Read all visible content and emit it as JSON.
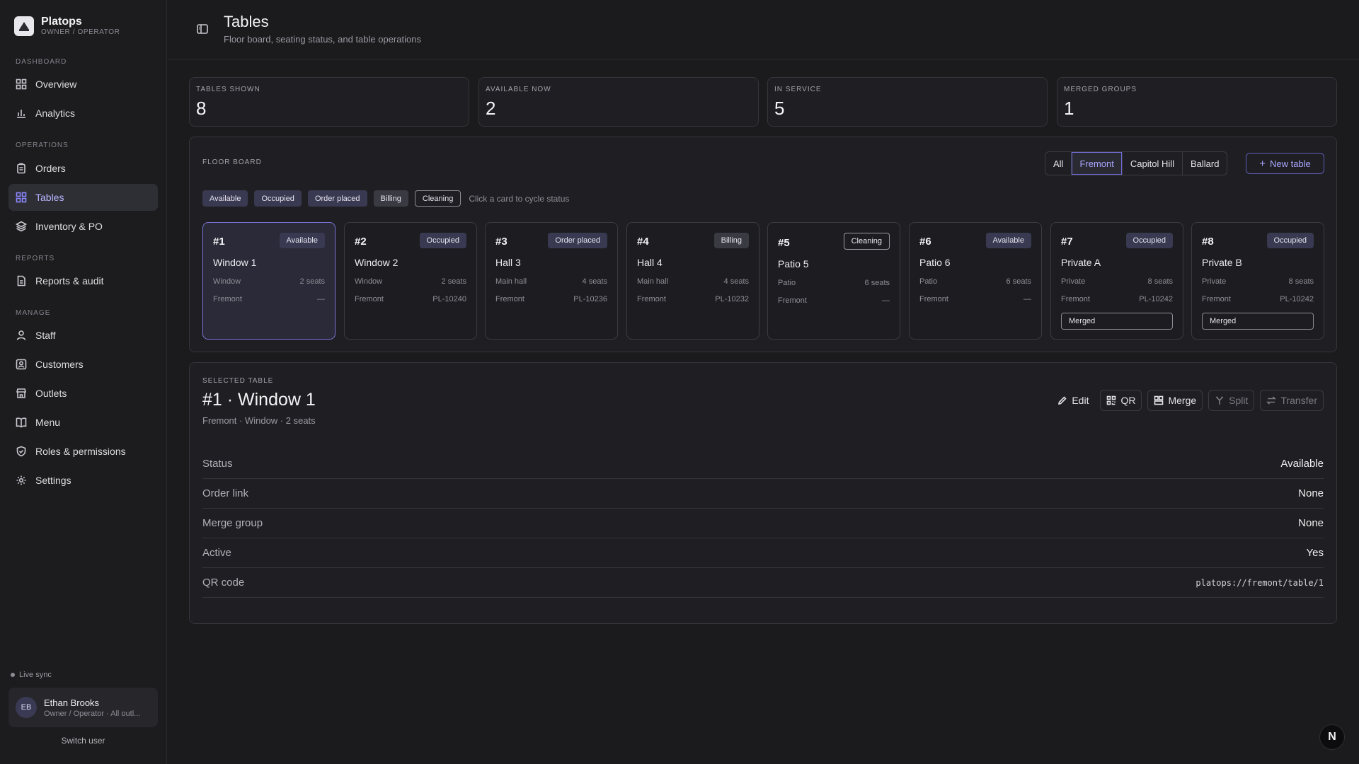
{
  "app": {
    "name": "Platops",
    "role": "OWNER / OPERATOR"
  },
  "sidebar": {
    "sections": [
      {
        "label": "DASHBOARD"
      },
      {
        "label": "OPERATIONS"
      },
      {
        "label": "REPORTS"
      },
      {
        "label": "MANAGE"
      }
    ],
    "items": [
      {
        "label": "Overview",
        "icon": "grid-icon"
      },
      {
        "label": "Analytics",
        "icon": "bar-chart-icon"
      },
      {
        "label": "Orders",
        "icon": "clipboard-icon"
      },
      {
        "label": "Tables",
        "icon": "grid-icon",
        "active": true
      },
      {
        "label": "Inventory & PO",
        "icon": "layers-icon"
      },
      {
        "label": "Reports & audit",
        "icon": "file-icon"
      },
      {
        "label": "Staff",
        "icon": "user-icon"
      },
      {
        "label": "Customers",
        "icon": "contact-icon"
      },
      {
        "label": "Outlets",
        "icon": "store-icon"
      },
      {
        "label": "Menu",
        "icon": "book-icon"
      },
      {
        "label": "Roles & permissions",
        "icon": "shield-icon"
      },
      {
        "label": "Settings",
        "icon": "gear-icon"
      }
    ],
    "live_sync": "Live sync",
    "user": {
      "initials": "EB",
      "name": "Ethan Brooks",
      "role": "Owner / Operator · All outl..."
    },
    "switch_user": "Switch user"
  },
  "header": {
    "title": "Tables",
    "subtitle": "Floor board, seating status, and table operations"
  },
  "stats": [
    {
      "label": "TABLES SHOWN",
      "value": "8"
    },
    {
      "label": "AVAILABLE NOW",
      "value": "2"
    },
    {
      "label": "IN SERVICE",
      "value": "5"
    },
    {
      "label": "MERGED GROUPS",
      "value": "1"
    }
  ],
  "floor_board": {
    "label": "FLOOR BOARD",
    "filters": [
      "All",
      "Fremont",
      "Capitol Hill",
      "Ballard"
    ],
    "active_filter": "Fremont",
    "new_table": "New table",
    "legend": [
      "Available",
      "Occupied",
      "Order placed",
      "Billing",
      "Cleaning"
    ],
    "hint": "Click a card to cycle status",
    "tables": [
      {
        "num": "#1",
        "status": "Available",
        "name": "Window 1",
        "area": "Window",
        "seats": "2 seats",
        "outlet": "Fremont",
        "order": "—",
        "merged": ""
      },
      {
        "num": "#2",
        "status": "Occupied",
        "name": "Window 2",
        "area": "Window",
        "seats": "2 seats",
        "outlet": "Fremont",
        "order": "PL-10240",
        "merged": ""
      },
      {
        "num": "#3",
        "status": "Order placed",
        "name": "Hall 3",
        "area": "Main hall",
        "seats": "4 seats",
        "outlet": "Fremont",
        "order": "PL-10236",
        "merged": ""
      },
      {
        "num": "#4",
        "status": "Billing",
        "name": "Hall 4",
        "area": "Main hall",
        "seats": "4 seats",
        "outlet": "Fremont",
        "order": "PL-10232",
        "merged": ""
      },
      {
        "num": "#5",
        "status": "Cleaning",
        "name": "Patio 5",
        "area": "Patio",
        "seats": "6 seats",
        "outlet": "Fremont",
        "order": "—",
        "merged": ""
      },
      {
        "num": "#6",
        "status": "Available",
        "name": "Patio 6",
        "area": "Patio",
        "seats": "6 seats",
        "outlet": "Fremont",
        "order": "—",
        "merged": ""
      },
      {
        "num": "#7",
        "status": "Occupied",
        "name": "Private A",
        "area": "Private",
        "seats": "8 seats",
        "outlet": "Fremont",
        "order": "PL-10242",
        "merged": "Merged"
      },
      {
        "num": "#8",
        "status": "Occupied",
        "name": "Private B",
        "area": "Private",
        "seats": "8 seats",
        "outlet": "Fremont",
        "order": "PL-10242",
        "merged": "Merged"
      }
    ]
  },
  "selected": {
    "label": "SELECTED TABLE",
    "title": "#1 · Window 1",
    "subtitle": "Fremont · Window · 2 seats",
    "actions": {
      "edit": "Edit",
      "qr": "QR",
      "merge": "Merge",
      "split": "Split",
      "transfer": "Transfer"
    },
    "details": [
      {
        "key": "Status",
        "value": "Available"
      },
      {
        "key": "Order link",
        "value": "None"
      },
      {
        "key": "Merge group",
        "value": "None"
      },
      {
        "key": "Active",
        "value": "Yes"
      },
      {
        "key": "QR code",
        "value": "platops://fremont/table/1"
      }
    ]
  },
  "corner_badge": "N"
}
